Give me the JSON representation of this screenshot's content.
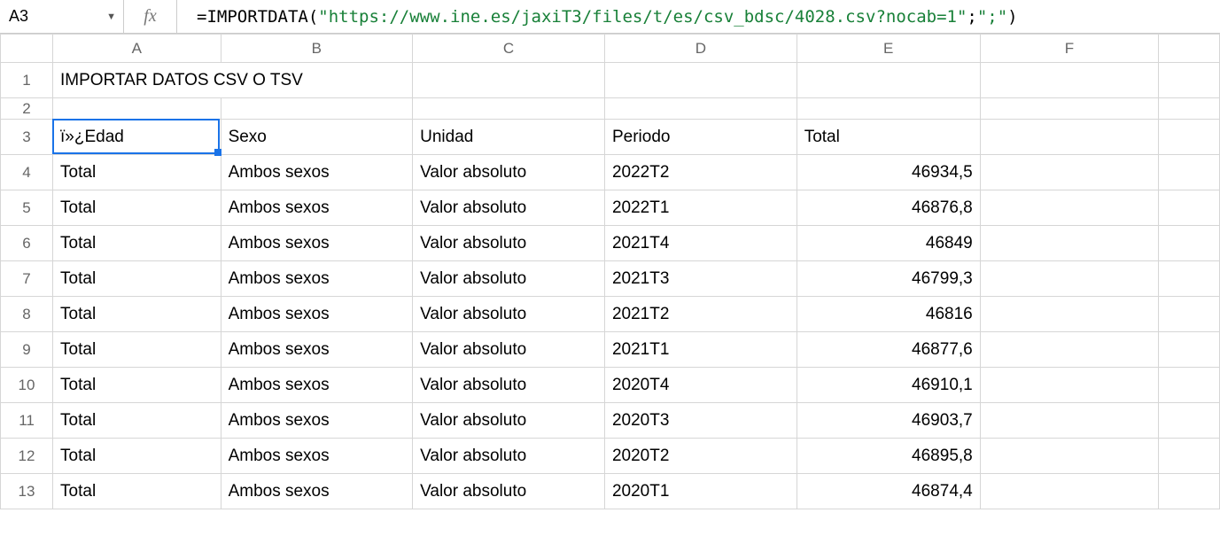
{
  "nameBox": "A3",
  "fx": "fx",
  "formula": {
    "eq": "=",
    "func": "IMPORTDATA",
    "lp": "(",
    "arg1": "\"https://www.ine.es/jaxiT3/files/t/es/csv_bdsc/4028.csv?nocab=1\"",
    "sep": ";",
    "arg2": "\";\"",
    "rp": ")"
  },
  "columns": [
    "A",
    "B",
    "C",
    "D",
    "E",
    "F",
    ""
  ],
  "rowNums": [
    "1",
    "2",
    "3",
    "4",
    "5",
    "6",
    "7",
    "8",
    "9",
    "10",
    "11",
    "12",
    "13"
  ],
  "title": "IMPORTAR DATOS CSV O TSV",
  "hdr": {
    "a": "ï»¿Edad",
    "b": "Sexo",
    "c": "Unidad",
    "d": "Periodo",
    "e": "Total"
  },
  "rows": [
    {
      "a": "Total",
      "b": "Ambos sexos",
      "c": "Valor absoluto",
      "d": "2022T2",
      "e": "46934,5"
    },
    {
      "a": "Total",
      "b": "Ambos sexos",
      "c": "Valor absoluto",
      "d": "2022T1",
      "e": "46876,8"
    },
    {
      "a": "Total",
      "b": "Ambos sexos",
      "c": "Valor absoluto",
      "d": "2021T4",
      "e": "46849"
    },
    {
      "a": "Total",
      "b": "Ambos sexos",
      "c": "Valor absoluto",
      "d": "2021T3",
      "e": "46799,3"
    },
    {
      "a": "Total",
      "b": "Ambos sexos",
      "c": "Valor absoluto",
      "d": "2021T2",
      "e": "46816"
    },
    {
      "a": "Total",
      "b": "Ambos sexos",
      "c": "Valor absoluto",
      "d": "2021T1",
      "e": "46877,6"
    },
    {
      "a": "Total",
      "b": "Ambos sexos",
      "c": "Valor absoluto",
      "d": "2020T4",
      "e": "46910,1"
    },
    {
      "a": "Total",
      "b": "Ambos sexos",
      "c": "Valor absoluto",
      "d": "2020T3",
      "e": "46903,7"
    },
    {
      "a": "Total",
      "b": "Ambos sexos",
      "c": "Valor absoluto",
      "d": "2020T2",
      "e": "46895,8"
    },
    {
      "a": "Total",
      "b": "Ambos sexos",
      "c": "Valor absoluto",
      "d": "2020T1",
      "e": "46874,4"
    }
  ]
}
